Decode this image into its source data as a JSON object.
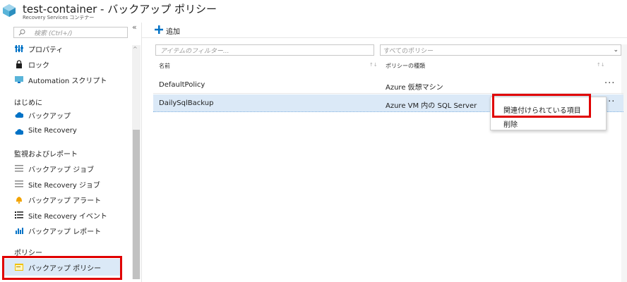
{
  "header": {
    "title": "test-container - バックアップ ポリシー",
    "subtitle": "Recovery Services コンテナー"
  },
  "sidebar": {
    "search_placeholder": "検索 (Ctrl+/)",
    "collapse": "«",
    "items_top": [
      {
        "label": "プロパティ",
        "icon": "properties-icon"
      },
      {
        "label": "ロック",
        "icon": "lock-icon"
      },
      {
        "label": "Automation スクリプト",
        "icon": "automation-script-icon"
      }
    ],
    "section_getting_started": "はじめに",
    "items_getting_started": [
      {
        "label": "バックアップ",
        "icon": "backup-cloud-icon"
      },
      {
        "label": "Site Recovery",
        "icon": "site-recovery-cloud-icon"
      }
    ],
    "section_monitoring": "監視およびレポート",
    "items_monitoring": [
      {
        "label": "バックアップ ジョブ",
        "icon": "jobs-list-icon"
      },
      {
        "label": "Site Recovery ジョブ",
        "icon": "jobs-list-icon"
      },
      {
        "label": "バックアップ アラート",
        "icon": "alert-bell-icon"
      },
      {
        "label": "Site Recovery イベント",
        "icon": "events-list-icon"
      },
      {
        "label": "バックアップ レポート",
        "icon": "report-chart-icon"
      }
    ],
    "section_policy": "ポリシー",
    "items_policy": [
      {
        "label": "バックアップ ポリシー",
        "icon": "policy-icon",
        "selected": true
      }
    ]
  },
  "toolbar": {
    "add_label": "追加"
  },
  "filter": {
    "placeholder": "アイテムのフィルター...",
    "policy_select_value": "すべてのポリシー"
  },
  "table": {
    "columns": [
      "名前",
      "ポリシーの種類"
    ],
    "rows": [
      {
        "name": "DefaultPolicy",
        "type": "Azure 仮想マシン",
        "more": "···"
      },
      {
        "name": "DailySqlBackup",
        "type": "Azure VM 内の SQL Server",
        "more": "···",
        "selected": true
      }
    ]
  },
  "context_menu": {
    "items": [
      "関連付けられている項目",
      "削除"
    ]
  },
  "colors": {
    "accent": "#0072c6",
    "selected_bg": "#dbe9f7",
    "highlight_red": "#e00000"
  }
}
